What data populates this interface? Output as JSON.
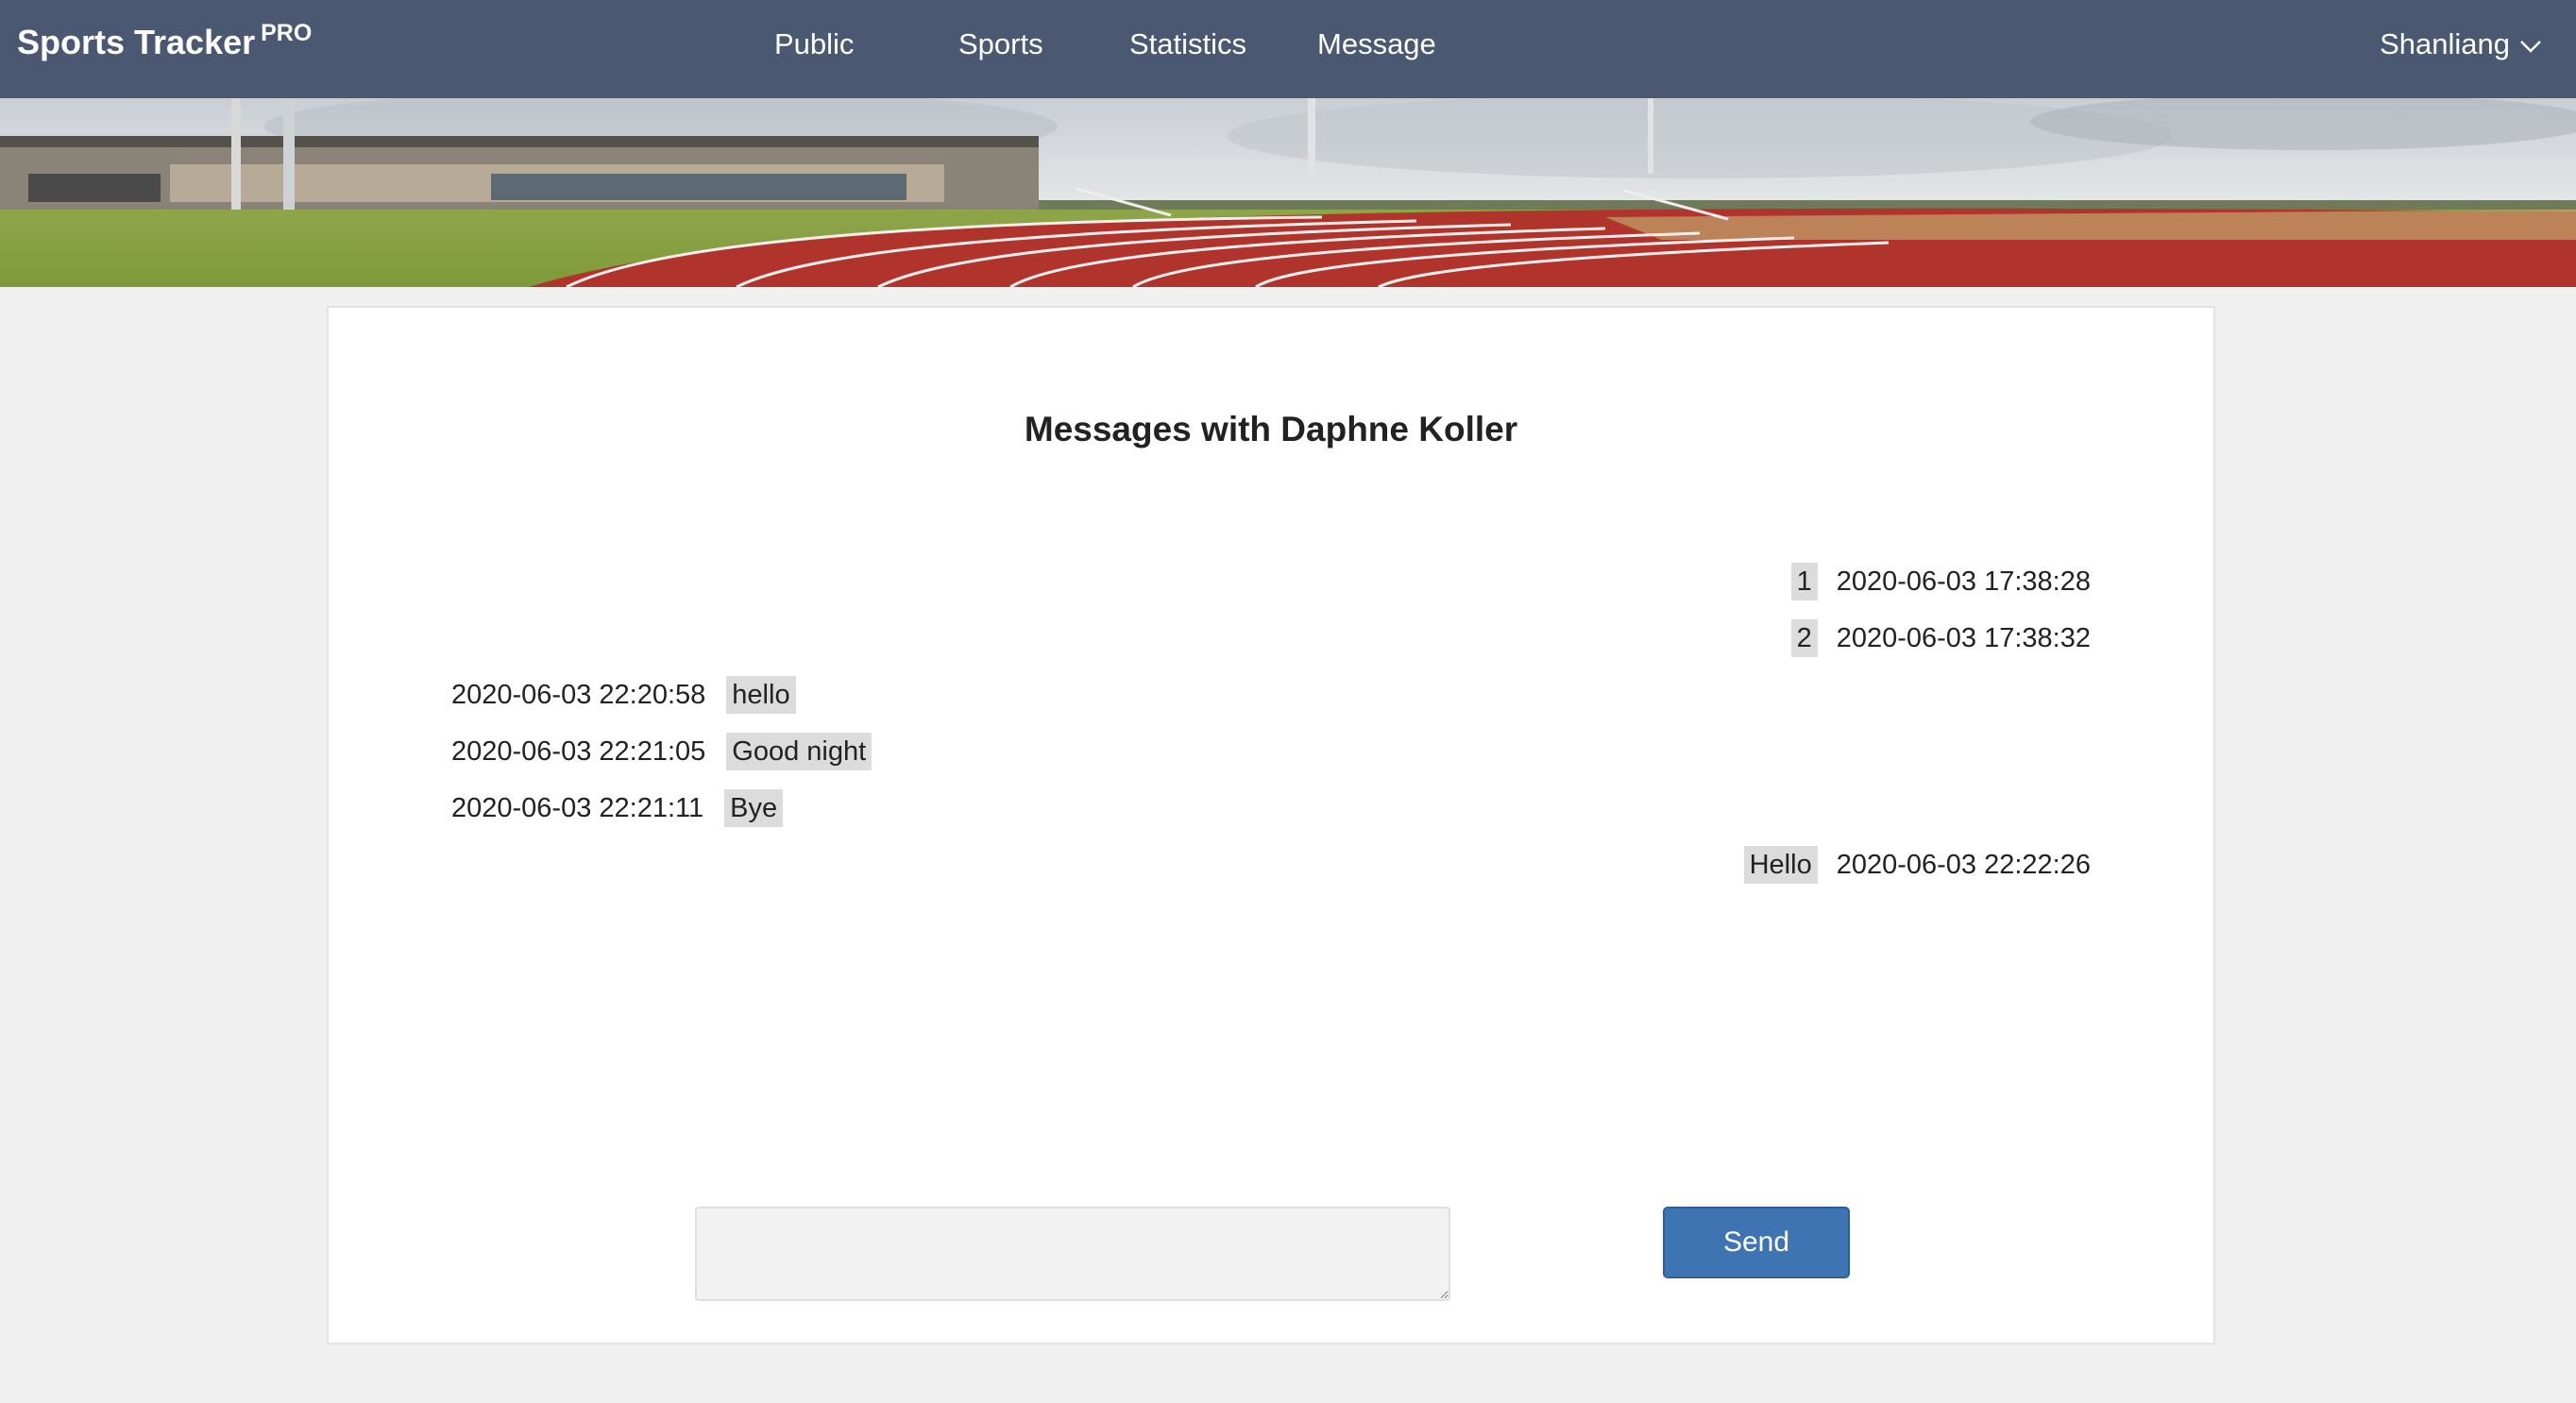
{
  "brand": {
    "name": "Sports Tracker",
    "badge": "PRO"
  },
  "nav": {
    "items": [
      {
        "label": "Public"
      },
      {
        "label": "Sports"
      },
      {
        "label": "Statistics"
      },
      {
        "label": "Message"
      }
    ],
    "user": "Shanliang"
  },
  "chat": {
    "title": "Messages with Daphne Koller",
    "messages": [
      {
        "side": "right",
        "text": "1",
        "time": "2020-06-03 17:38:28"
      },
      {
        "side": "right",
        "text": "2",
        "time": "2020-06-03 17:38:32"
      },
      {
        "side": "left",
        "text": "hello",
        "time": "2020-06-03 22:20:58"
      },
      {
        "side": "left",
        "text": "Good night",
        "time": "2020-06-03 22:21:05"
      },
      {
        "side": "left",
        "text": "Bye",
        "time": "2020-06-03 22:21:11"
      },
      {
        "side": "right",
        "text": "Hello",
        "time": "2020-06-03 22:22:26"
      }
    ],
    "compose_value": "",
    "send_label": "Send"
  },
  "colors": {
    "navbar": "#4b5872",
    "send_button": "#3f74b3",
    "bubble": "#dcdcdc",
    "page_background": "#f0f0f0"
  },
  "icons": {
    "user_menu": "chevron-down-icon",
    "banner": "running-track-banner-image"
  }
}
